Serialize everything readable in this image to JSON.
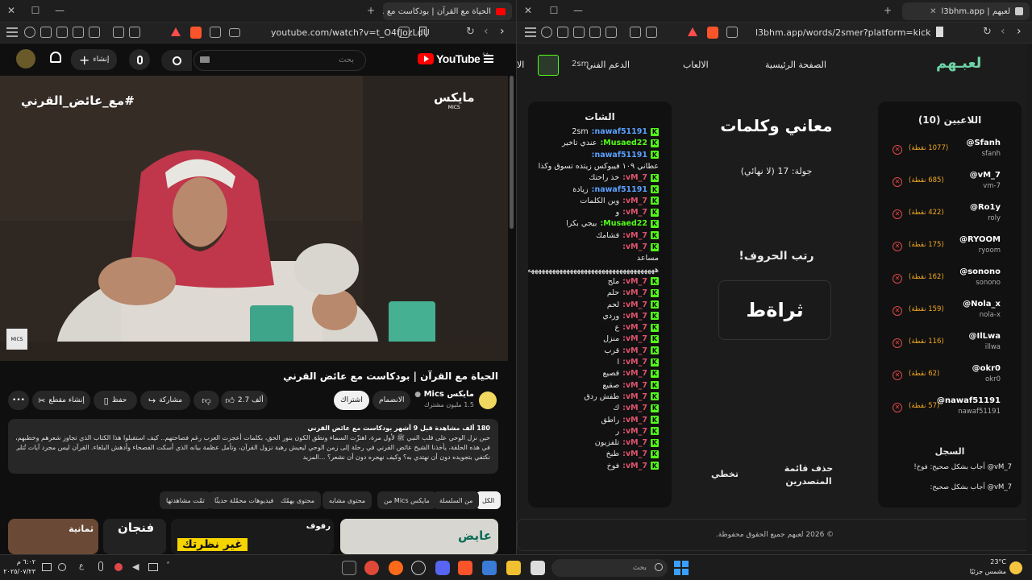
{
  "left_window": {
    "tab": {
      "title": "الحياة مع القرآن | بودكاست مع ..."
    },
    "url": "youtube.com/watch?v=t_O4fJozLdU",
    "youtube": {
      "logo_text": "YouTube",
      "logo_region": "SA",
      "search_placeholder": "بحث",
      "create_label": "إنشاء",
      "video_overlay_tag": "#مع_عائض_القرني",
      "channel_watermark": "مايكس",
      "watermark_sub": "MICS",
      "title": "الحياة مع القرآن | بودكاست مع عائض القرني",
      "channel": {
        "name": "مايكس Mics",
        "subscribers": "1.5 مليون مشترك"
      },
      "join_label": "الانضمام",
      "subscribe_label": "اشتراك",
      "likes": "2.7 ألف",
      "share_label": "مشاركة",
      "save_label": "حفظ",
      "clip_label": "إنشاء مقطع",
      "description": {
        "stats": "180 ألف مشاهدة  قبل 9 أشهر  بودكاست مع عائض القرني",
        "lines": [
          "حين نزل الوحي على قلب النبي ﷺ لأول مرة، اهتزّت السماء ونطق الكون بنور الحق، بكلمات أعجزت العرب رغم فصاحتهم.. كيف استقبلوا هذا الكتاب الذي تجاوز شعرهم وخطبهم، وأعجز بلاغتهم؟",
          "في هذه الحلقة، يأخذنا الشيخ عائض القرني في رحلة إلى زمن الوحي ليعيش رهبة نزول القرآن، وتأمل عظمة بيانه الذي أسكت الفصحاء وأدهش البلغاء. القرآن ليس مجرد آيات تُتلى، بل نور يُهتدى به. فكيف",
          "نكتفي بتجويده دون أن نهتدي به؟ وكيف نهجره دون أن نشعر؟ ...المزيد"
        ]
      },
      "chips": [
        "الكل",
        "من السلسلة",
        "من Mics مايكس",
        "محتوى مشابه",
        "محتوى يهمّك",
        "فيديوهات محمّلة حديثًا",
        "تمّت مشاهدتها"
      ],
      "thumbnails": [
        {
          "label": "ثمانية"
        },
        {
          "label": "فنجان",
          "sub": "غير نظرتك"
        },
        {
          "label": "رفوف"
        },
        {
          "label": "عايض"
        }
      ]
    }
  },
  "right_window": {
    "tab": {
      "title": "لعبهم | l3bhm.app"
    },
    "url": "l3bhm.app/words/2smer?platform=kick",
    "nav": {
      "logo": "لعبـهم",
      "items": [
        "الصفحة الرئيسية",
        "الالعاب",
        "الدعم الفني",
        "الا"
      ],
      "user": "2sm"
    },
    "players_panel": {
      "title": "اللاعبين (10)",
      "players": [
        {
          "name": "@Sfanh",
          "sub": "sfanh",
          "points": "(1077 نقطة)"
        },
        {
          "name": "@vM_7",
          "sub": "vm-7",
          "points": "(685 نقطة)"
        },
        {
          "name": "@Ro1y",
          "sub": "roly",
          "points": "(422 نقطة)"
        },
        {
          "name": "@RYOOM",
          "sub": "ryoom",
          "points": "(175 نقطة)"
        },
        {
          "name": "@sonono",
          "sub": "sonono",
          "points": "(162 نقطة)"
        },
        {
          "name": "@Nola_x",
          "sub": "nola-x",
          "points": "(159 نقطة)"
        },
        {
          "name": "@IlLwa",
          "sub": "illwa",
          "points": "(116 نقطة)"
        },
        {
          "name": "@okr0",
          "sub": "okr0",
          "points": "(62 نقطة)"
        },
        {
          "name": "@nawaf51191",
          "sub": "nawaf51191",
          "points": "(57 نقطة)"
        }
      ],
      "log_title": "السجل",
      "log": [
        "vM_7@ أجاب بشكل صحيح: فوخ!",
        "vM_7@ أجاب بشكل صحيح:"
      ]
    },
    "game": {
      "title": "معاني وكلمات",
      "round": "جولة: 17 (لا نهائي)",
      "prompt": "رتب الحروف!",
      "scrambled": "ثراةط",
      "btn_clear": "حذف قائمة المتصدرين",
      "btn_skip": "تخطي"
    },
    "chat": {
      "title": "الشات",
      "messages": [
        {
          "user": "nawaf51191:",
          "text": "2sm",
          "c": "un2"
        },
        {
          "user": "Musaed22:",
          "text": "عندي تاخير",
          "c": "un3"
        },
        {
          "user": "nawaf51191:",
          "text": "",
          "c": "un2"
        },
        {
          "user": "",
          "text": "عطاني ١٠٩ فيبوكس زيتده تسوق وكذا",
          "c": ""
        },
        {
          "user": "vM_7:",
          "text": "خذ راحتك",
          "c": "un"
        },
        {
          "user": "nawaf51191:",
          "text": "زيادة",
          "c": "un2"
        },
        {
          "user": "vM_7:",
          "text": "وين الكلمات",
          "c": "un"
        },
        {
          "user": "vM_7:",
          "text": "و",
          "c": "un"
        },
        {
          "user": "Musaed22:",
          "text": "بيجي بكرا",
          "c": "un3"
        },
        {
          "user": "vM_7:",
          "text": "قشامك",
          "c": "un"
        },
        {
          "user": "vM_7:",
          "text": "",
          "c": "un"
        },
        {
          "user": "",
          "text": "مساعد",
          "c": ""
        },
        {
          "user": "",
          "text": "ههههههههههههههههههههههههههههههههههههه",
          "c": ""
        },
        {
          "user": "vM_7:",
          "text": "ملح",
          "c": "un"
        },
        {
          "user": "vM_7:",
          "text": "حلم",
          "c": "un"
        },
        {
          "user": "vM_7:",
          "text": "لحم",
          "c": "un"
        },
        {
          "user": "vM_7:",
          "text": "وردي",
          "c": "un"
        },
        {
          "user": "vM_7:",
          "text": "ع",
          "c": "un"
        },
        {
          "user": "vM_7:",
          "text": "منزل",
          "c": "un"
        },
        {
          "user": "vM_7:",
          "text": "قرب",
          "c": "un"
        },
        {
          "user": "vM_7:",
          "text": "ا",
          "c": "un"
        },
        {
          "user": "vM_7:",
          "text": "قصيع",
          "c": "un"
        },
        {
          "user": "vM_7:",
          "text": "صقيع",
          "c": "un"
        },
        {
          "user": "vM_7:",
          "text": "طفش ردق",
          "c": "un"
        },
        {
          "user": "vM_7:",
          "text": "ك",
          "c": "un"
        },
        {
          "user": "vM_7:",
          "text": "راطق",
          "c": "un"
        },
        {
          "user": "vM_7:",
          "text": "ر",
          "c": "un"
        },
        {
          "user": "vM_7:",
          "text": "تلفزيون",
          "c": "un"
        },
        {
          "user": "vM_7:",
          "text": "طبخ",
          "c": "un"
        },
        {
          "user": "vM_7:",
          "text": "فوخ",
          "c": "un"
        }
      ]
    },
    "footer": "© 2026 لعبهم جميع الحقوق محفوظة."
  },
  "taskbar": {
    "search_placeholder": "بحث",
    "weather_temp": "23°C",
    "weather_desc": "مشمس جزئيًا",
    "time": "٦:٠٢ م",
    "date": "٢٠٢٥/٠٧/٢٣"
  },
  "colors": {
    "accent_green": "#53fc18",
    "yt_red": "#ff0000",
    "points": "#f0a820",
    "remove": "#e04848"
  }
}
